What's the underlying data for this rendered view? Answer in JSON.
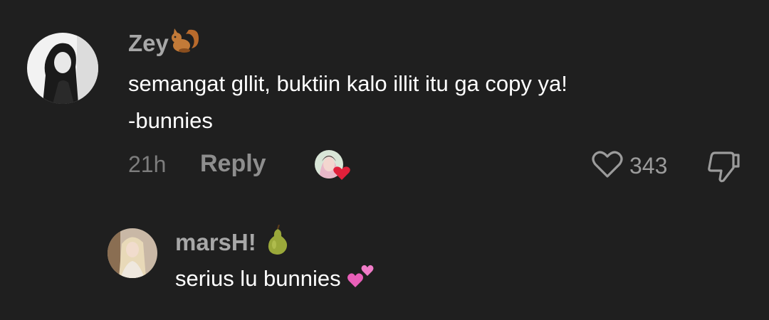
{
  "comments": [
    {
      "author": "Zey",
      "author_emoji_icon": "squirrel-icon",
      "text_lines": [
        "semangat gllit, buktiin kalo illit itu ga copy ya!",
        "-bunnies"
      ],
      "time": "21h",
      "reply_label": "Reply",
      "like_count": "343"
    }
  ],
  "replies": [
    {
      "author": "marsH!",
      "author_emoji_icon": "pear-icon",
      "text": "serius lu bunnies",
      "text_emoji_icon": "two-hearts-icon"
    }
  ],
  "colors": {
    "background": "#1f1f1f",
    "username": "#a7a7a7",
    "meta": "#7d7d7d",
    "heart_badge": "#e0203a"
  }
}
